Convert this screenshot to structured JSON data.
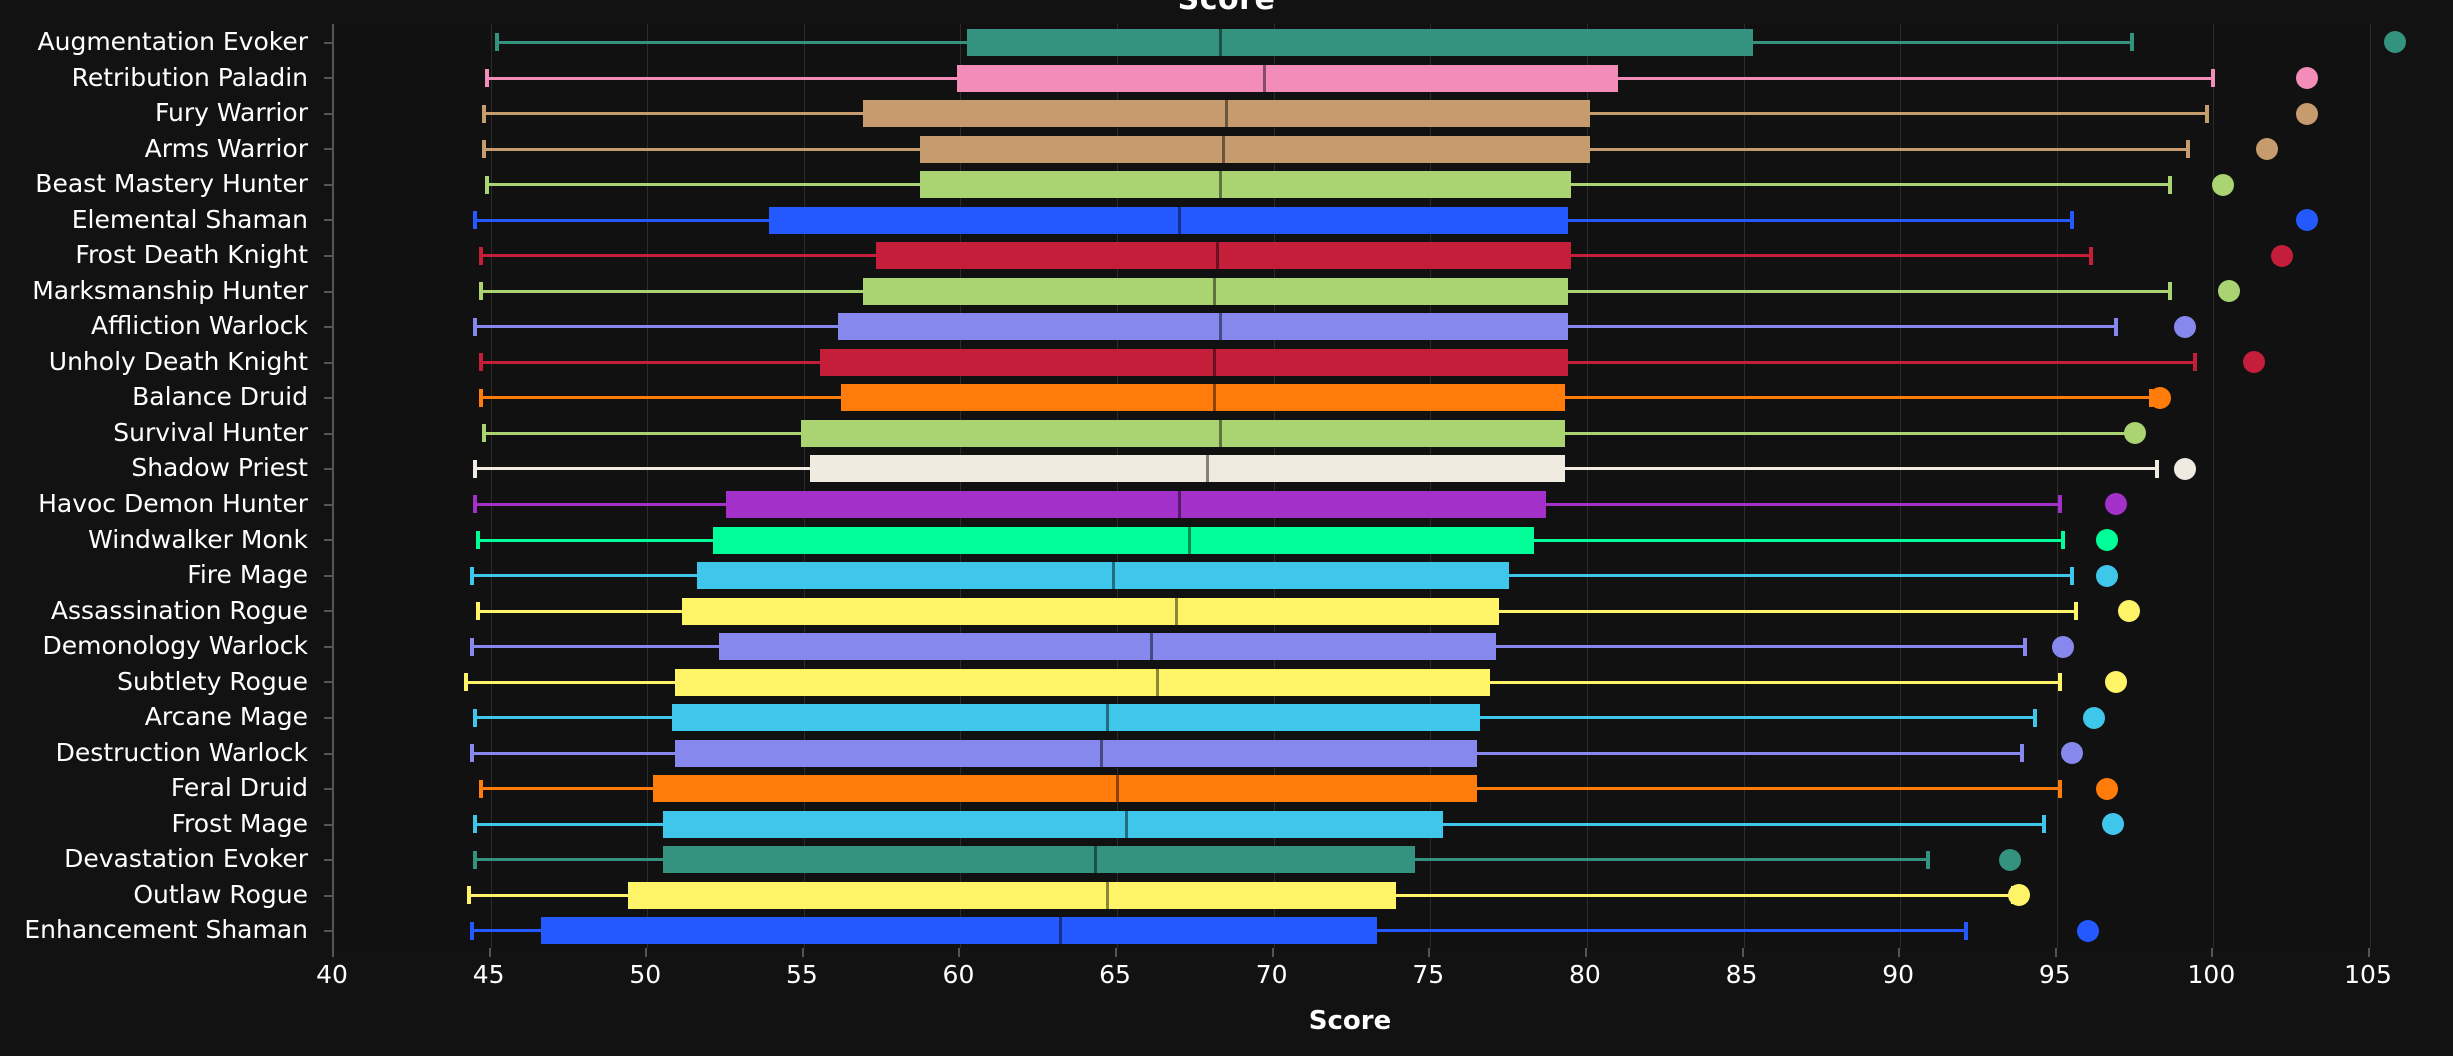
{
  "chart_title": "Score",
  "axis": {
    "x_title": "Score",
    "x_min": 40,
    "x_max": 105,
    "x_ticks": [
      40,
      45,
      50,
      55,
      60,
      65,
      70,
      75,
      80,
      85,
      90,
      95,
      100,
      105
    ]
  },
  "chart_data": {
    "type": "box",
    "title": "Score",
    "xlabel": "Score",
    "ylabel": "",
    "xlim": [
      40,
      105
    ],
    "grid": true,
    "legend": "none",
    "orientation": "horizontal",
    "categories": [
      "Augmentation Evoker",
      "Retribution Paladin",
      "Fury Warrior",
      "Arms Warrior",
      "Beast Mastery Hunter",
      "Elemental Shaman",
      "Frost Death Knight",
      "Marksmanship Hunter",
      "Affliction Warlock",
      "Unholy Death Knight",
      "Balance Druid",
      "Survival Hunter",
      "Shadow Priest",
      "Havoc Demon Hunter",
      "Windwalker Monk",
      "Fire Mage",
      "Assassination Rogue",
      "Demonology Warlock",
      "Subtlety Rogue",
      "Arcane Mage",
      "Destruction Warlock",
      "Feral Druid",
      "Frost Mage",
      "Devastation Evoker",
      "Outlaw Rogue",
      "Enhancement Shaman"
    ],
    "boxes": [
      {
        "name": "Augmentation Evoker",
        "color": "#33937F",
        "low": 45.2,
        "q1": 60.2,
        "median": 68.3,
        "q3": 85.3,
        "high": 97.4,
        "outliers": [
          105.8
        ]
      },
      {
        "name": "Retribution Paladin",
        "color": "#F48CBA",
        "low": 44.9,
        "q1": 59.9,
        "median": 69.7,
        "q3": 81.0,
        "high": 100.0,
        "outliers": [
          103.0
        ]
      },
      {
        "name": "Fury Warrior",
        "color": "#C69B6D",
        "low": 44.8,
        "q1": 56.9,
        "median": 68.5,
        "q3": 80.1,
        "high": 99.8,
        "outliers": [
          103.0
        ]
      },
      {
        "name": "Arms Warrior",
        "color": "#C69B6D",
        "low": 44.8,
        "q1": 58.7,
        "median": 68.4,
        "q3": 80.1,
        "high": 99.2,
        "outliers": [
          101.7
        ]
      },
      {
        "name": "Beast Mastery Hunter",
        "color": "#AAD372",
        "low": 44.9,
        "q1": 58.7,
        "median": 68.3,
        "q3": 79.5,
        "high": 98.6,
        "outliers": [
          100.3
        ]
      },
      {
        "name": "Elemental Shaman",
        "color": "#2459FF",
        "low": 44.5,
        "q1": 53.9,
        "median": 67.0,
        "q3": 79.4,
        "high": 95.5,
        "outliers": [
          103.0
        ]
      },
      {
        "name": "Frost Death Knight",
        "color": "#C41E3A",
        "low": 44.7,
        "q1": 57.3,
        "median": 68.2,
        "q3": 79.5,
        "high": 96.1,
        "outliers": [
          102.2
        ]
      },
      {
        "name": "Marksmanship Hunter",
        "color": "#AAD372",
        "low": 44.7,
        "q1": 56.9,
        "median": 68.1,
        "q3": 79.4,
        "high": 98.6,
        "outliers": [
          100.5
        ]
      },
      {
        "name": "Affliction Warlock",
        "color": "#8788EE",
        "low": 44.5,
        "q1": 56.1,
        "median": 68.3,
        "q3": 79.4,
        "high": 96.9,
        "outliers": [
          99.1
        ]
      },
      {
        "name": "Unholy Death Knight",
        "color": "#C41E3A",
        "low": 44.7,
        "q1": 55.5,
        "median": 68.1,
        "q3": 79.4,
        "high": 99.4,
        "outliers": [
          101.3
        ]
      },
      {
        "name": "Balance Druid",
        "color": "#FF7C0A",
        "low": 44.7,
        "q1": 56.2,
        "median": 68.1,
        "q3": 79.3,
        "high": 98.0,
        "outliers": [
          98.3
        ]
      },
      {
        "name": "Survival Hunter",
        "color": "#AAD372",
        "low": 44.8,
        "q1": 54.9,
        "median": 68.3,
        "q3": 79.3,
        "high": 97.6,
        "outliers": [
          97.5
        ]
      },
      {
        "name": "Shadow Priest",
        "color": "#F0EBE0",
        "low": 44.5,
        "q1": 55.2,
        "median": 67.9,
        "q3": 79.3,
        "high": 98.2,
        "outliers": [
          99.1
        ]
      },
      {
        "name": "Havoc Demon Hunter",
        "color": "#A330C9",
        "low": 44.5,
        "q1": 52.5,
        "median": 67.0,
        "q3": 78.7,
        "high": 95.1,
        "outliers": [
          96.9
        ]
      },
      {
        "name": "Windwalker Monk",
        "color": "#00FF98",
        "low": 44.6,
        "q1": 52.1,
        "median": 67.3,
        "q3": 78.3,
        "high": 95.2,
        "outliers": [
          96.6
        ]
      },
      {
        "name": "Fire Mage",
        "color": "#3FC7EB",
        "low": 44.4,
        "q1": 51.6,
        "median": 64.9,
        "q3": 77.5,
        "high": 95.5,
        "outliers": [
          96.6
        ]
      },
      {
        "name": "Assassination Rogue",
        "color": "#FFF468",
        "low": 44.6,
        "q1": 51.1,
        "median": 66.9,
        "q3": 77.2,
        "high": 95.6,
        "outliers": [
          97.3
        ]
      },
      {
        "name": "Demonology Warlock",
        "color": "#8788EE",
        "low": 44.4,
        "q1": 52.3,
        "median": 66.1,
        "q3": 77.1,
        "high": 94.0,
        "outliers": [
          95.2
        ]
      },
      {
        "name": "Subtlety Rogue",
        "color": "#FFF468",
        "low": 44.2,
        "q1": 50.9,
        "median": 66.3,
        "q3": 76.9,
        "high": 95.1,
        "outliers": [
          96.9
        ]
      },
      {
        "name": "Arcane Mage",
        "color": "#3FC7EB",
        "low": 44.5,
        "q1": 50.8,
        "median": 64.7,
        "q3": 76.6,
        "high": 94.3,
        "outliers": [
          96.2
        ]
      },
      {
        "name": "Destruction Warlock",
        "color": "#8788EE",
        "low": 44.4,
        "q1": 50.9,
        "median": 64.5,
        "q3": 76.5,
        "high": 93.9,
        "outliers": [
          95.5
        ]
      },
      {
        "name": "Feral Druid",
        "color": "#FF7C0A",
        "low": 44.7,
        "q1": 50.2,
        "median": 65.0,
        "q3": 76.5,
        "high": 95.1,
        "outliers": [
          96.6
        ]
      },
      {
        "name": "Frost Mage",
        "color": "#3FC7EB",
        "low": 44.5,
        "q1": 50.5,
        "median": 65.3,
        "q3": 75.4,
        "high": 94.6,
        "outliers": [
          96.8
        ]
      },
      {
        "name": "Devastation Evoker",
        "color": "#33937F",
        "low": 44.5,
        "q1": 50.5,
        "median": 64.3,
        "q3": 74.5,
        "high": 90.9,
        "outliers": [
          93.5
        ]
      },
      {
        "name": "Outlaw Rogue",
        "color": "#FFF468",
        "low": 44.3,
        "q1": 49.4,
        "median": 64.7,
        "q3": 73.9,
        "high": 93.6,
        "outliers": [
          93.8
        ]
      },
      {
        "name": "Enhancement Shaman",
        "color": "#2459FF",
        "low": 44.4,
        "q1": 46.6,
        "median": 63.2,
        "q3": 73.3,
        "high": 92.1,
        "outliers": [
          96.0
        ]
      }
    ]
  }
}
